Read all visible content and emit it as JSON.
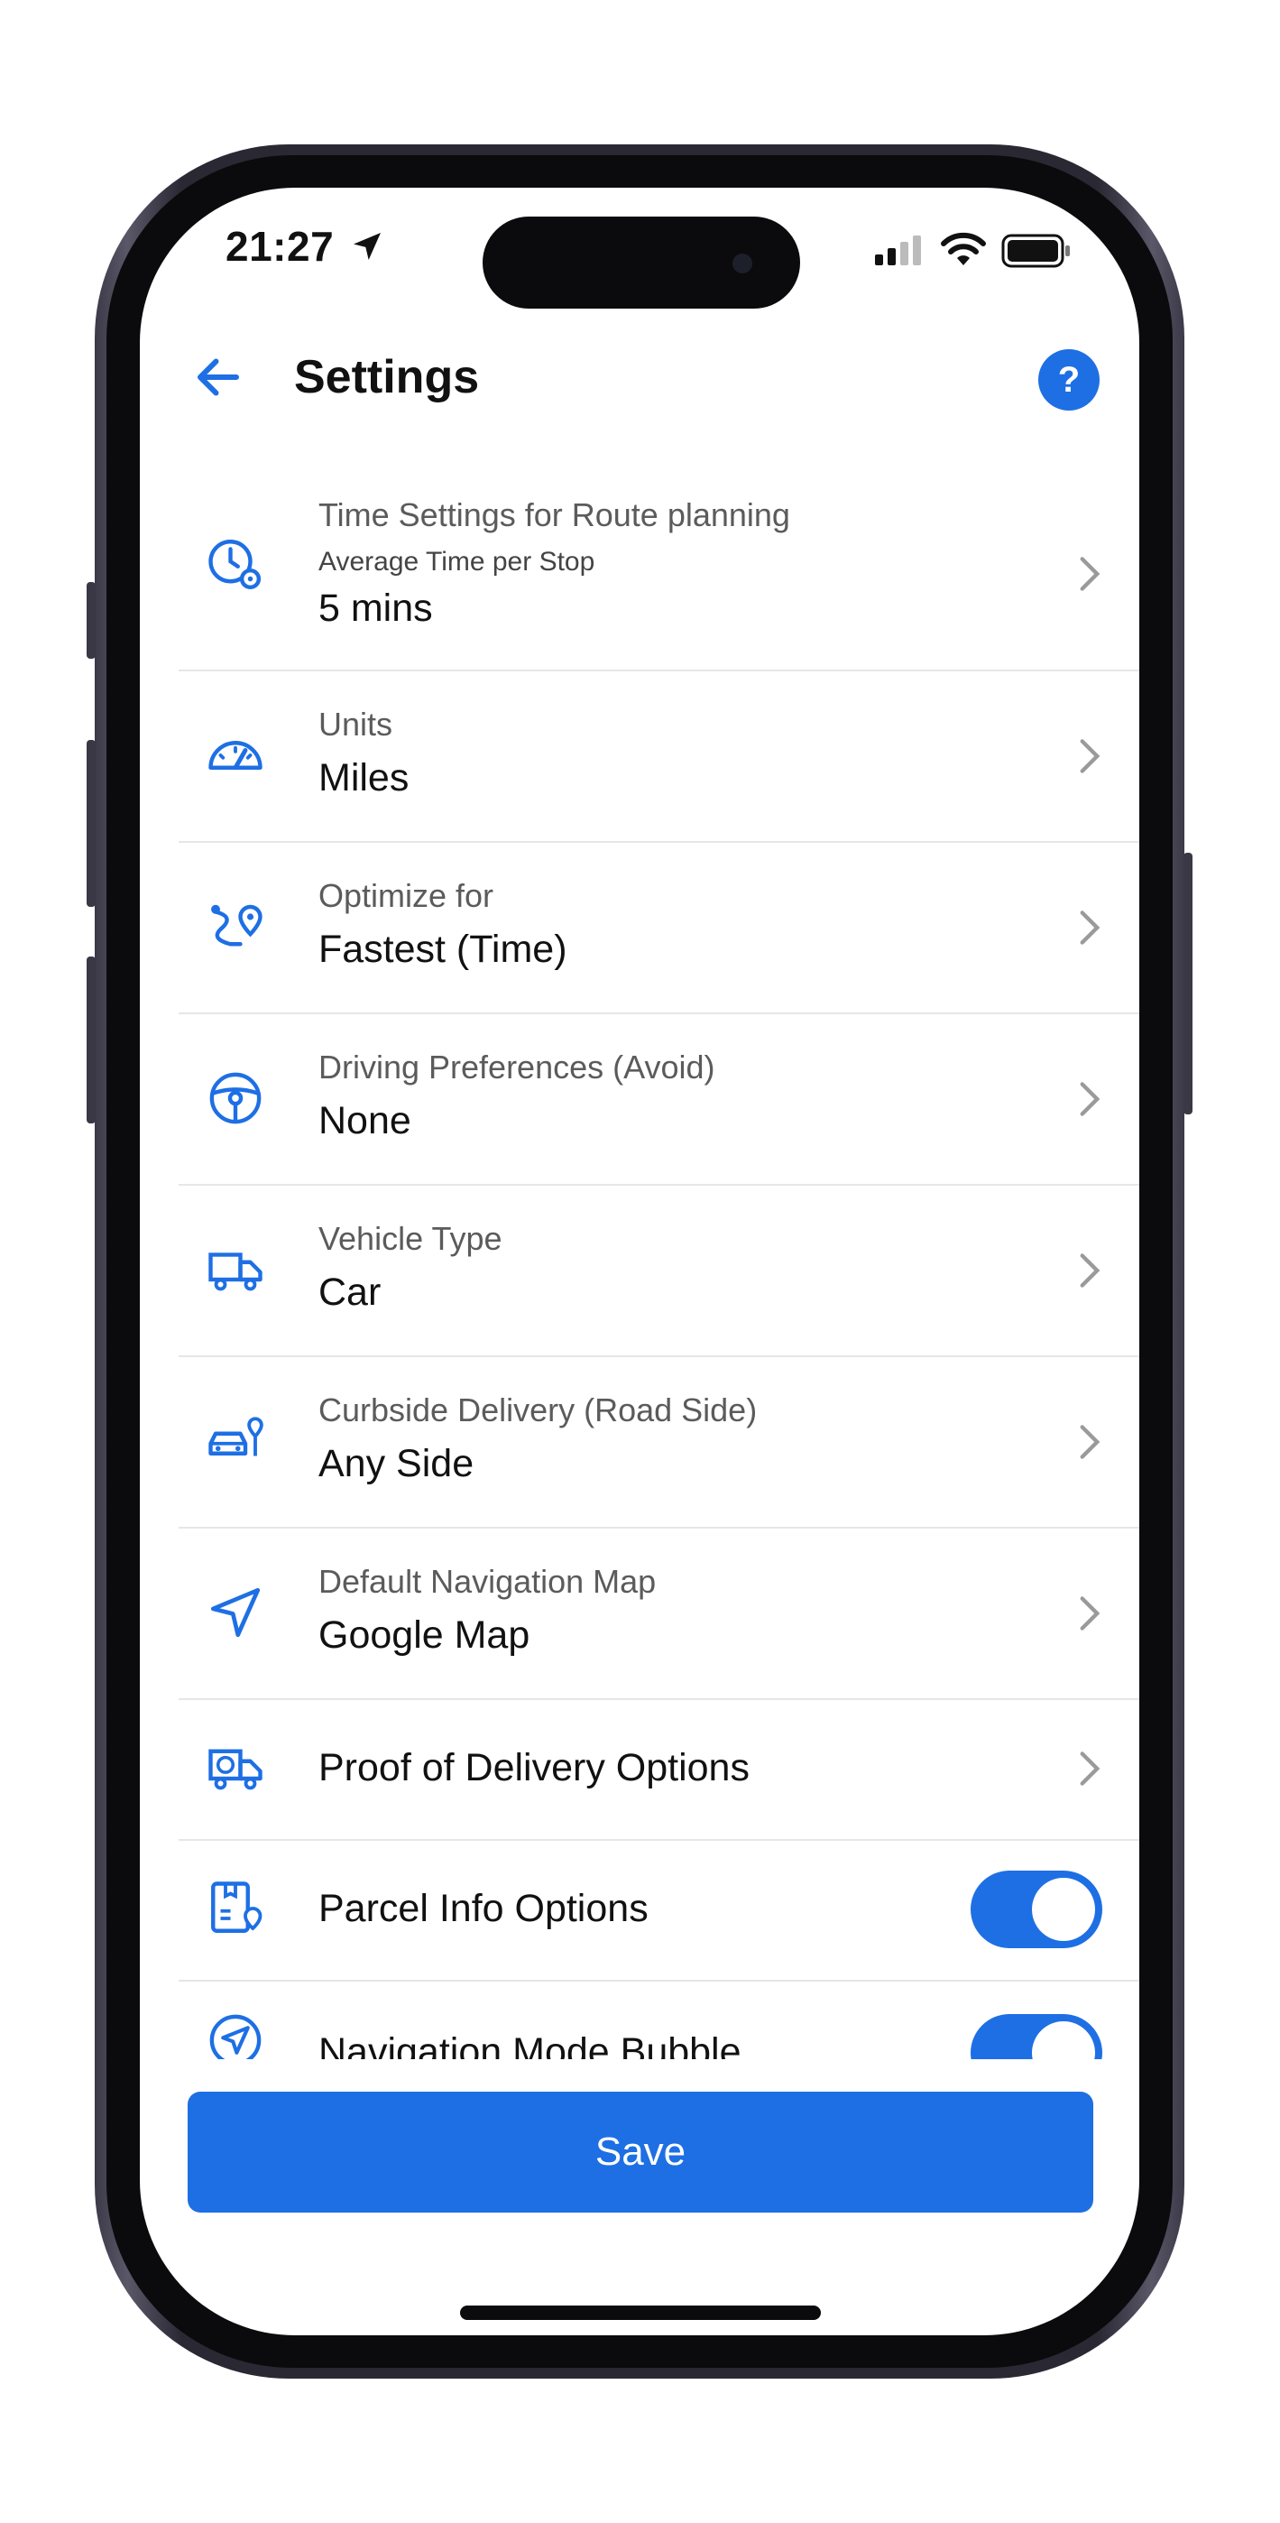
{
  "status_bar": {
    "time": "21:27"
  },
  "header": {
    "title": "Settings",
    "help_label": "?"
  },
  "settings": {
    "time": {
      "label": "Time Settings for Route planning",
      "sub": "Average Time per Stop",
      "value": "5 mins"
    },
    "units": {
      "label": "Units",
      "value": "Miles"
    },
    "optimize": {
      "label": "Optimize for",
      "value": "Fastest (Time)"
    },
    "driving": {
      "label": "Driving Preferences (Avoid)",
      "value": "None"
    },
    "vehicle": {
      "label": "Vehicle Type",
      "value": "Car"
    },
    "curbside": {
      "label": "Curbside Delivery (Road Side)",
      "value": "Any Side"
    },
    "navmap": {
      "label": "Default Navigation Map",
      "value": "Google Map"
    },
    "proof": {
      "label": "Proof of Delivery Options"
    },
    "parcel": {
      "label": "Parcel Info Options",
      "enabled": true
    },
    "bubble": {
      "label": "Navigation Mode Bubble",
      "enabled": true
    }
  },
  "actions": {
    "save_label": "Save"
  },
  "colors": {
    "accent": "#1e6fe4",
    "divider": "#e6e6e6",
    "icon_stroke": "#1e6fe4"
  }
}
